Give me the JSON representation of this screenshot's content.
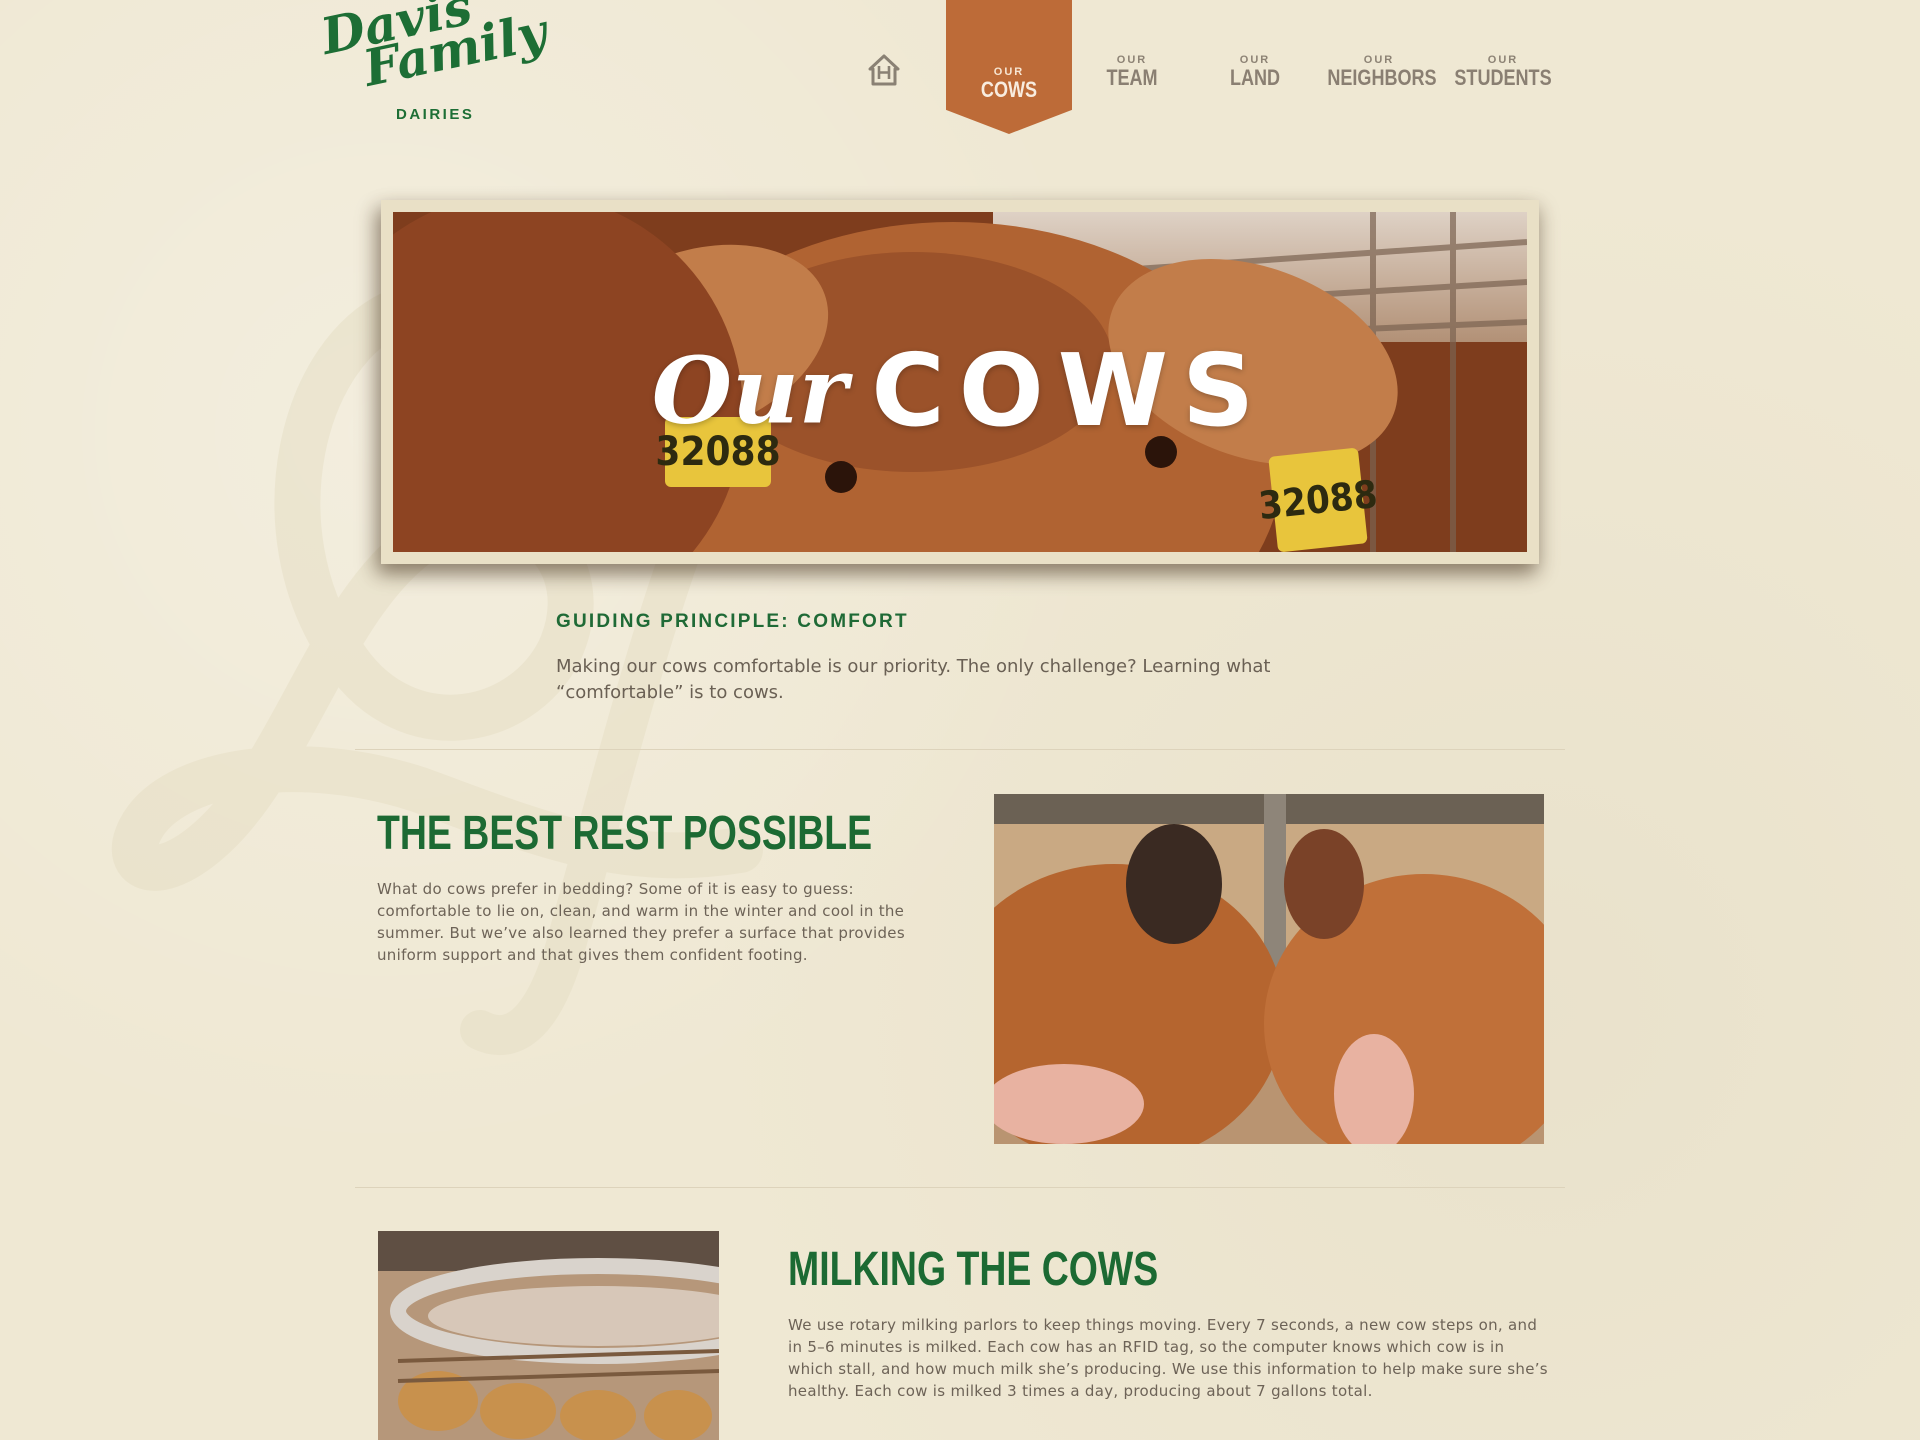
{
  "brand": {
    "logo_script": "Davis\n  Family",
    "logo_sub": "DAIRIES",
    "colors": {
      "green": "#1d6e35",
      "copper": "#bd6b38",
      "background": "#efe8d3"
    }
  },
  "nav": {
    "home_icon": "home-icon",
    "items": [
      {
        "small": "OUR",
        "big": "COWS"
      },
      {
        "small": "OUR",
        "big": "TEAM"
      },
      {
        "small": "OUR",
        "big": "LAND"
      },
      {
        "small": "OUR",
        "big": "NEIGHBORS"
      },
      {
        "small": "OUR",
        "big": "STUDENTS"
      }
    ],
    "active": "COWS"
  },
  "hero": {
    "script": "Our",
    "caps": "COWS",
    "tag_left": "32088",
    "tag_right": "32088"
  },
  "intro": {
    "title": "GUIDING PRINCIPLE: COMFORT",
    "text": "Making our cows comfortable is our priority. The only challenge? Learning what “comfortable” is to cows."
  },
  "sections": [
    {
      "title": "THE BEST REST POSSIBLE",
      "text": "What do cows prefer in bedding? Some of it is easy to guess: comfortable to lie on, clean, and warm in the winter and cool in the summer. But we’ve also learned they prefer a surface that provides uniform support and that gives them confident footing."
    },
    {
      "title": "MILKING THE COWS",
      "text": "We use rotary milking parlors to keep things moving. Every 7 seconds, a new cow steps on, and in 5–6 minutes is milked. Each cow has an RFID tag, so the computer knows which cow is in which stall, and how much milk she’s producing. We use this information to help make sure she’s healthy. Each cow is milked 3 times a day, producing about 7 gallons total."
    }
  ]
}
